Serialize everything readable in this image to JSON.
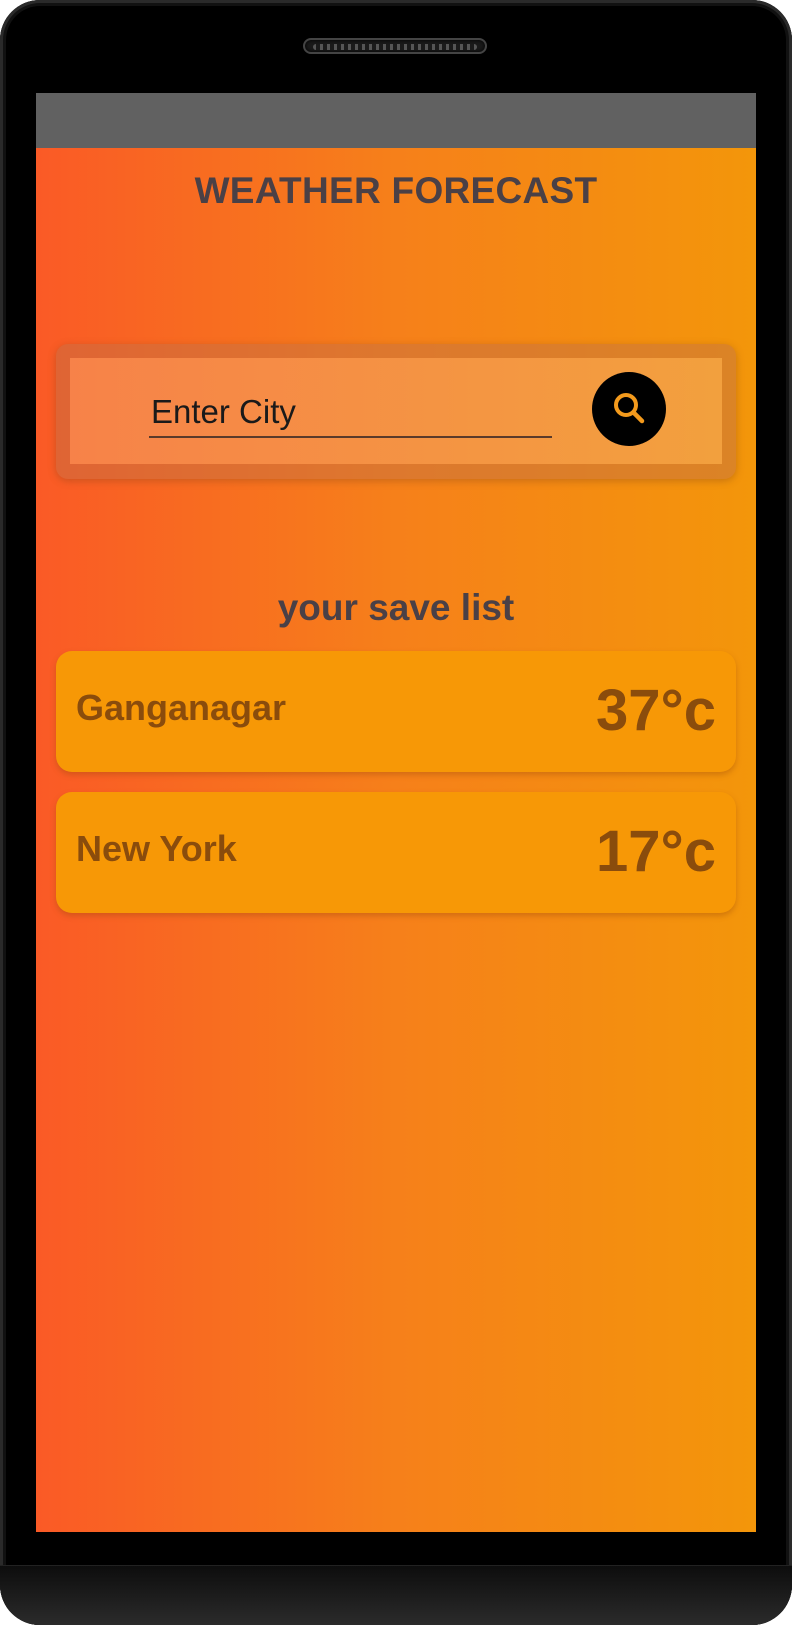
{
  "app": {
    "title": "WEATHER FORECAST"
  },
  "search": {
    "placeholder": "Enter City",
    "button_icon": "search-icon"
  },
  "saved": {
    "heading": "your save list",
    "items": [
      {
        "city": "Ganganagar",
        "temp": "37°c"
      },
      {
        "city": "New York",
        "temp": "17°c"
      }
    ]
  },
  "colors": {
    "gradient_start": "#fa5a26",
    "gradient_end": "#f3960a",
    "card": "#f79806",
    "card_text": "#8a4c0c",
    "heading_text": "#4a4046",
    "status_bar": "#616161"
  }
}
